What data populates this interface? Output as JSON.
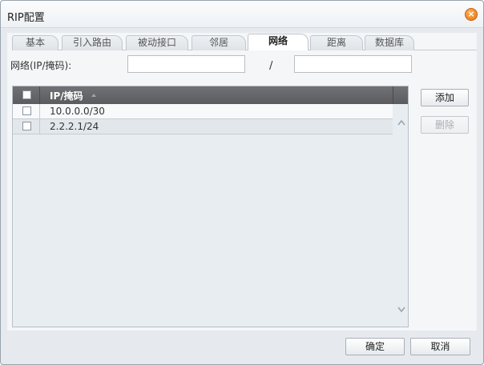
{
  "dialog": {
    "title": "RIP配置",
    "close_icon": "close-icon"
  },
  "tabs": [
    {
      "label": "基本",
      "active": false
    },
    {
      "label": "引入路由",
      "active": false
    },
    {
      "label": "被动接口",
      "active": false
    },
    {
      "label": "邻居",
      "active": false
    },
    {
      "label": "网络",
      "active": true
    },
    {
      "label": "距离",
      "active": false
    },
    {
      "label": "数据库",
      "active": false
    }
  ],
  "network_form": {
    "label": "网络(IP/掩码):",
    "ip_value": "",
    "mask_value": "",
    "separator": "/"
  },
  "table": {
    "column_header": "IP/掩码",
    "rows": [
      {
        "value": "10.0.0.0/30",
        "checked": false
      },
      {
        "value": "2.2.2.1/24",
        "checked": false
      }
    ]
  },
  "side_buttons": {
    "add_label": "添加",
    "delete_label": "删除"
  },
  "footer": {
    "ok_label": "确定",
    "cancel_label": "取消"
  }
}
